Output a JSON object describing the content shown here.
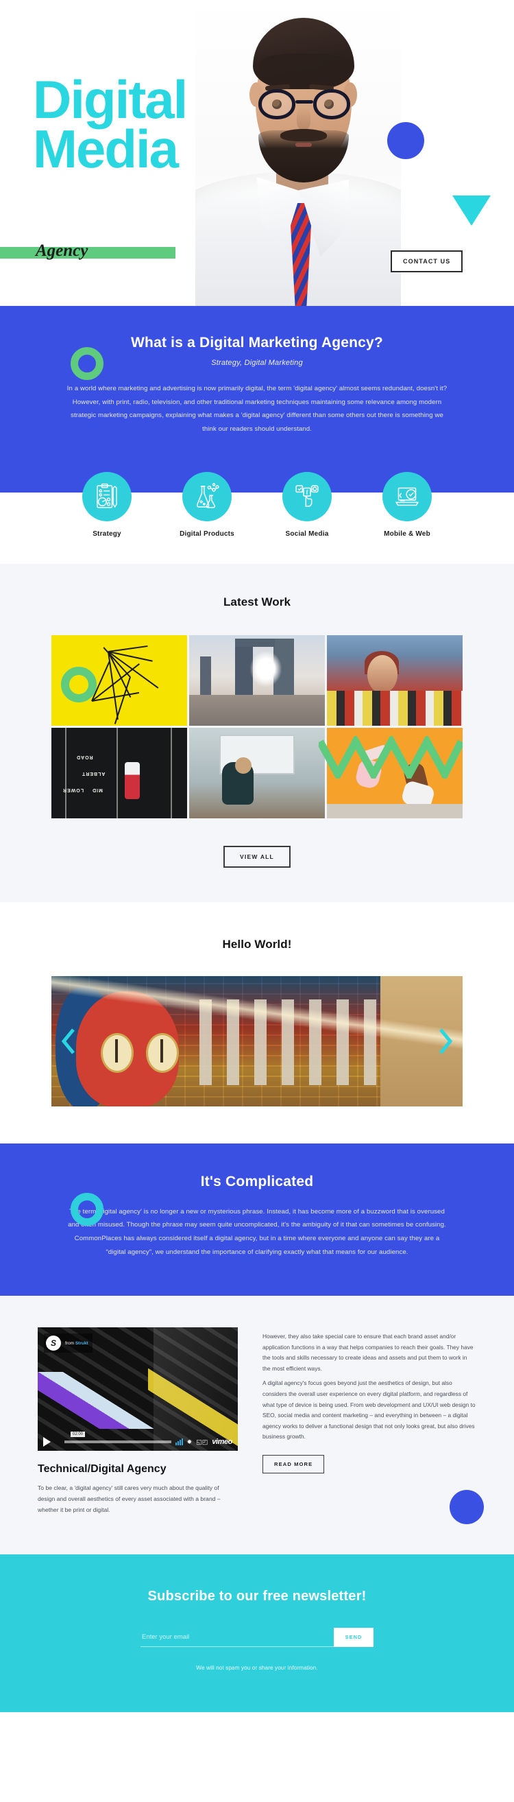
{
  "hero": {
    "title_line1": "Digital",
    "title_line2": "Media",
    "tagline": "Agency",
    "contact_button": "CONTACT US",
    "accent_cyan": "#2ad6e0",
    "accent_blue": "#3a50e2",
    "accent_green": "#5fcb7f"
  },
  "intro": {
    "heading": "What is a Digital Marketing Agency?",
    "subheading": "Strategy, Digital Marketing",
    "body": "In a world where marketing and advertising is now primarily digital, the term 'digital agency' almost seems redundant, doesn't it? However, with print, radio, television, and other traditional marketing techniques maintaining some relevance among modern strategic marketing campaigns, explaining what makes a 'digital agency' different than some others out there is something we think our readers should understand."
  },
  "services": [
    {
      "label": "Strategy",
      "icon": "clipboard-chart-icon"
    },
    {
      "label": "Digital Products",
      "icon": "flask-molecule-icon"
    },
    {
      "label": "Social Media",
      "icon": "social-hand-icon"
    },
    {
      "label": "Mobile & Web",
      "icon": "laptop-check-icon"
    }
  ],
  "work": {
    "title": "Latest Work",
    "view_all": "VIEW ALL",
    "tiles": [
      {
        "name": "yellow-geometric-wires"
      },
      {
        "name": "city-bridge-cyclists"
      },
      {
        "name": "street-art-mural-posters"
      },
      {
        "name": "aerial-road-markings-car"
      },
      {
        "name": "studio-man-whiteboard"
      },
      {
        "name": "dancers-orange-wall"
      }
    ]
  },
  "carousel": {
    "title": "Hello World!",
    "slide_name": "dublin-owl-graffiti-mural",
    "prev_label": "Previous slide",
    "next_label": "Next slide"
  },
  "complicated": {
    "heading": "It's Complicated",
    "body": "The term 'digital agency' is no longer a new or mysterious phrase. Instead, it has become more of a buzzword that is overused and often misused. Though the phrase may seem quite uncomplicated, it's the ambiguity of it that can sometimes be confusing. CommonPlaces has always considered itself a digital agency, but in a time where everyone and anyone can say they are a “digital agency”, we understand the importance of clarifying exactly what that means for our audience."
  },
  "technical": {
    "video": {
      "from_prefix": "from",
      "from_source": "Strukt",
      "timestamp": "02:00",
      "provider": "vimeo"
    },
    "heading": "Technical/Digital Agency",
    "left_body": "To be clear, a 'digital agency' still cares very much about the quality of design and overall aesthetics of every asset associated with a brand – whether it be print or digital.",
    "right_body_1": "However, they also take special care to ensure that each brand asset and/or application functions in a way that helps companies to reach their goals. They have the tools and skills necessary to create ideas and assets and put them to work in the most efficient ways.",
    "right_body_2": "A digital agency's focus goes beyond just the aesthetics of design, but also considers the overall user experience on every digital platform, and regardless of what type of device is being used. From web development and UX/UI web design to SEO, social media and content marketing – and everything in between – a digital agency works to deliver a functional design that not only looks great, but also drives business growth.",
    "read_more": "READ MORE"
  },
  "newsletter": {
    "heading": "Subscribe to our free newsletter!",
    "placeholder": "Enter your email",
    "value": "",
    "send_label": "SEND",
    "note": "We will not spam you or share your information.",
    "background": "#2fd0dc"
  }
}
